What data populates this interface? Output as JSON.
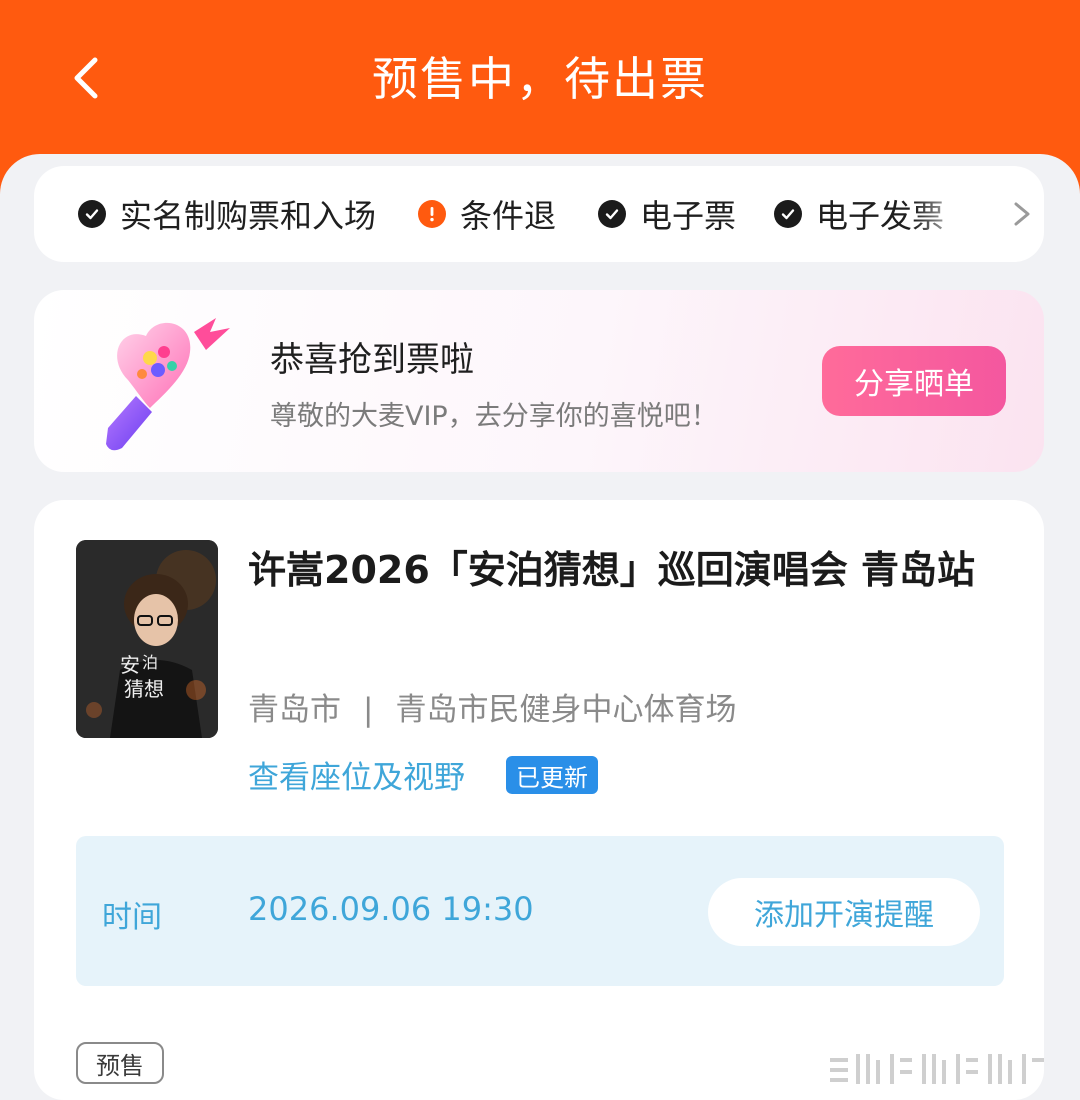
{
  "header": {
    "title": "预售中，待出票",
    "bg_color": "#ff5a0f"
  },
  "service_tags": [
    {
      "label": "实名制购票和入场",
      "icon": "check-icon"
    },
    {
      "label": "条件退",
      "icon": "exclamation-icon"
    },
    {
      "label": "电子票",
      "icon": "check-icon"
    },
    {
      "label": "电子发票",
      "icon": "check-icon"
    }
  ],
  "congrats": {
    "title": "恭喜抢到票啦",
    "subtitle": "尊敬的大麦VIP，去分享你的喜悦吧！",
    "share_button": "分享晒单",
    "share_color": "#f4579f"
  },
  "order": {
    "title": "许嵩2026「安泊猜想」巡回演唱会 青岛站",
    "city": "青岛市",
    "separator": "|",
    "venue": "青岛市民健身中心体育场",
    "seat_link": "查看座位及视野",
    "updated_badge": "已更新",
    "time_label": "时间",
    "time_value": "2026.09.06 19:30",
    "reminder_button": "添加开演提醒",
    "status_badge": "预售",
    "accent_color": "#3fa6d9"
  }
}
